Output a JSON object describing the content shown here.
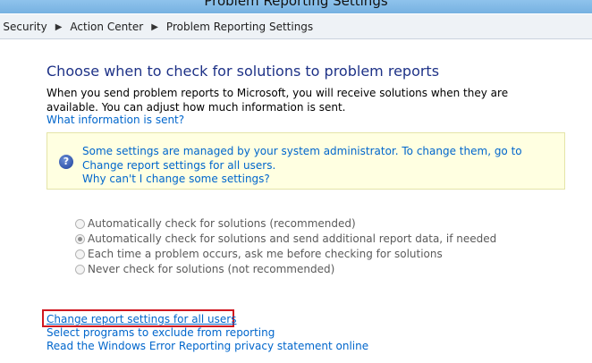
{
  "window": {
    "title": "Problem Reporting Settings"
  },
  "breadcrumb": [
    "d Security",
    "Action Center",
    "Problem Reporting Settings"
  ],
  "main": {
    "heading": "Choose when to check for solutions to problem reports",
    "description": "When you send problem reports to Microsoft, you will receive solutions when they are available. You can adjust how much information is sent.",
    "what_info_link": "What information is sent?"
  },
  "infobox": {
    "icon": "question-icon",
    "message": "Some settings are managed by your system administrator. To change them, go to Change report settings for all users.",
    "why_link": "Why can't I change some settings?"
  },
  "options": [
    {
      "label": "Automatically check for solutions (recommended)",
      "checked": false,
      "enabled": false
    },
    {
      "label": "Automatically check for solutions and send additional report data, if needed",
      "checked": true,
      "enabled": false
    },
    {
      "label": "Each time a problem occurs, ask me before checking for solutions",
      "checked": false,
      "enabled": false
    },
    {
      "label": "Never check for solutions (not recommended)",
      "checked": false,
      "enabled": false
    }
  ],
  "links": {
    "change_all_users": "Change report settings for all users",
    "exclude_programs": "Select programs to exclude from reporting",
    "privacy_statement": "Read the Windows Error Reporting privacy statement online"
  },
  "colors": {
    "heading": "#1e3287",
    "link": "#0066cc",
    "highlight": "#d01820",
    "infobox_bg": "#ffffe1"
  }
}
